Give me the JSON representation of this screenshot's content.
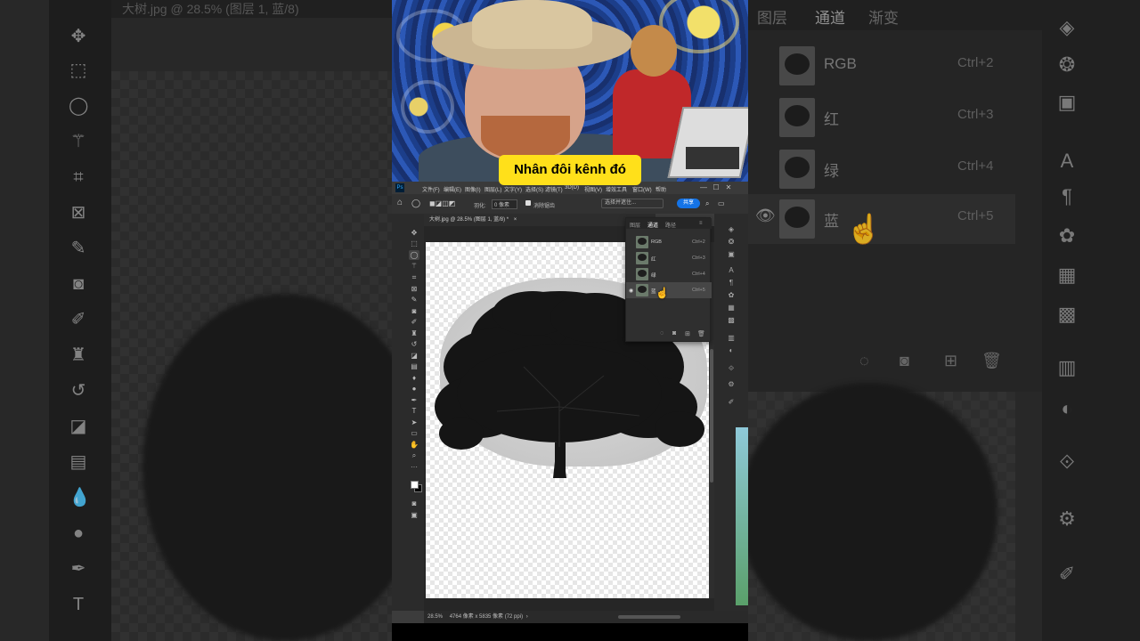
{
  "caption": "Nhân đôi kênh đó",
  "background_left": {
    "title": "大树.jpg @ 28.5% (图层 1, 蓝/8)"
  },
  "background_right": {
    "tabs": [
      "图层",
      "通道",
      "渐变"
    ],
    "channels": [
      {
        "name": "RGB",
        "shortcut": "Ctrl+2"
      },
      {
        "name": "红",
        "shortcut": "Ctrl+3"
      },
      {
        "name": "绿",
        "shortcut": "Ctrl+4"
      },
      {
        "name": "蓝",
        "shortcut": "Ctrl+5"
      }
    ]
  },
  "photoshop": {
    "menu": [
      "文件(F)",
      "编辑(E)",
      "图像(I)",
      "图层(L)",
      "文字(Y)",
      "选择(S)",
      "滤镜(T)",
      "3D(D)",
      "视图(V)",
      "增效工具",
      "窗口(W)",
      "帮助"
    ],
    "options": {
      "feather_label": "羽化:",
      "feather_value": "0 像素",
      "antialias": "消除锯齿",
      "select_mask": "选择并遮住...",
      "share": "共享"
    },
    "document_tab": "大树.jpg @ 28.5% (图层 1, 蓝/8) *",
    "panel": {
      "tabs": [
        "图层",
        "通道",
        "路径"
      ],
      "active_tab": "通道",
      "channels": [
        {
          "name": "RGB",
          "shortcut": "Ctrl+2"
        },
        {
          "name": "红",
          "shortcut": "Ctrl+3"
        },
        {
          "name": "绿",
          "shortcut": "Ctrl+4"
        },
        {
          "name": "蓝",
          "shortcut": "Ctrl+5"
        }
      ]
    },
    "status": {
      "zoom": "28.5%",
      "size": "4764 像素 x 5835 像素 (72 ppi)"
    }
  },
  "icons": {
    "tools": [
      "move-icon",
      "marquee-icon",
      "lasso-icon",
      "magic-wand-icon",
      "crop-icon",
      "frame-icon",
      "eyedropper-icon",
      "healing-icon",
      "brush-icon",
      "stamp-icon",
      "history-brush-icon",
      "eraser-icon",
      "gradient-icon",
      "blur-icon",
      "dodge-icon",
      "pen-icon",
      "type-icon",
      "path-select-icon",
      "rectangle-icon",
      "hand-icon",
      "zoom-icon",
      "more-icon"
    ]
  },
  "colors": {
    "caption_bg": "#ffe01a",
    "share_button": "#1473e6",
    "ps_logo": "#31a8ff"
  }
}
